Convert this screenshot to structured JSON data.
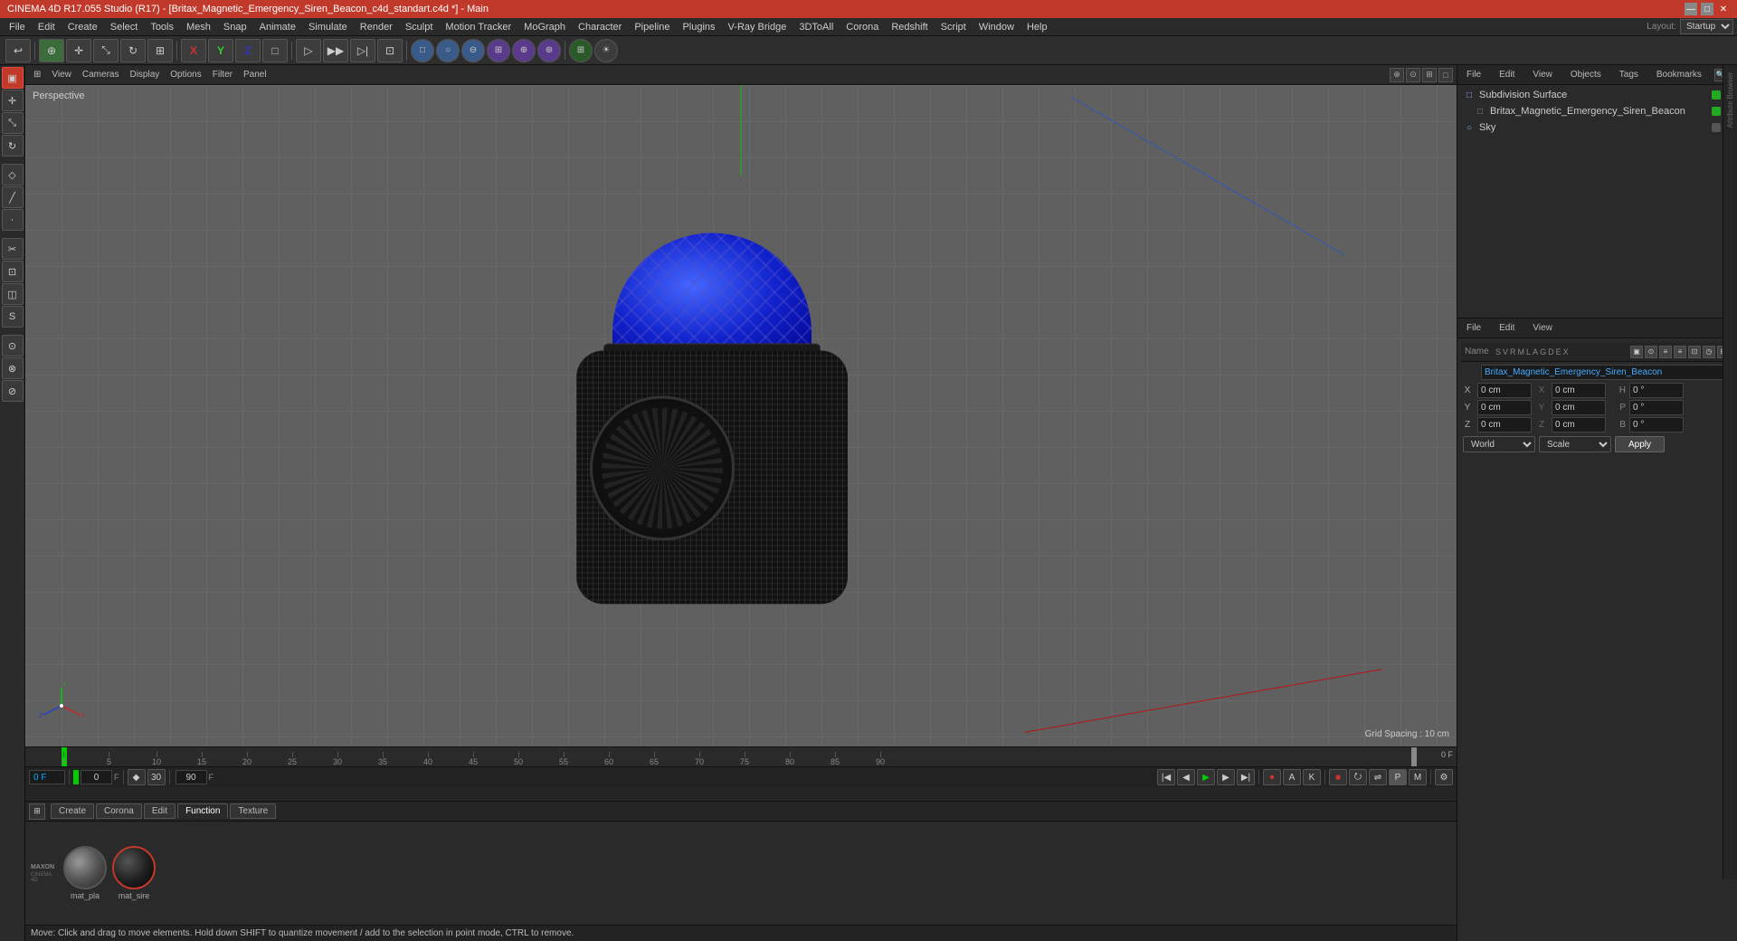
{
  "titleBar": {
    "title": "CINEMA 4D R17.055 Studio (R17) - [Britax_Magnetic_Emergency_Siren_Beacon_c4d_standart.c4d *] - Main",
    "minimize": "—",
    "maximize": "□",
    "close": "✕"
  },
  "menuBar": {
    "items": [
      "File",
      "Edit",
      "Create",
      "Select",
      "Tools",
      "Mesh",
      "Snap",
      "Animate",
      "Simulate",
      "Render",
      "Sculpt",
      "Motion Tracker",
      "MoGraph",
      "Character",
      "Pipeline",
      "Plugins",
      "V-Ray Bridge",
      "3DToAll",
      "Corona",
      "Redshift",
      "Script",
      "Window",
      "Help"
    ]
  },
  "layout": {
    "label": "Layout:",
    "value": "Startup"
  },
  "viewport": {
    "perspectiveLabel": "Perspective",
    "gridSpacing": "Grid Spacing : 10 cm",
    "tabs": [
      "View",
      "Cameras",
      "Display",
      "Options",
      "Filter",
      "Panel"
    ]
  },
  "objectManager": {
    "tabs": [
      "File",
      "Edit",
      "View",
      "Objects",
      "Tags",
      "Bookmarks"
    ],
    "objects": [
      {
        "name": "Subdivision Surface",
        "level": 0,
        "icon": "□",
        "dotColors": [
          "green",
          "orange"
        ]
      },
      {
        "name": "Britax_Magnetic_Emergency_Siren_Beacon",
        "level": 1,
        "icon": "□",
        "dotColors": [
          "green",
          "orange"
        ]
      },
      {
        "name": "Sky",
        "level": 0,
        "icon": "○",
        "dotColors": [
          "grey",
          "orange"
        ]
      }
    ]
  },
  "attrManager": {
    "tabs": [
      "File",
      "Edit",
      "View"
    ],
    "nameLabel": "Name",
    "nameValue": "Britax_Magnetic_Emergency_Siren_Beacon",
    "headers": [
      "S",
      "V",
      "R",
      "M",
      "L",
      "A",
      "G",
      "D",
      "E",
      "X"
    ],
    "coords": {
      "x": {
        "pos": "0 cm",
        "scale": "0 cm",
        "angle": "0 °"
      },
      "y": {
        "pos": "0 cm",
        "scale": "0 cm",
        "angle": "0 °"
      },
      "z": {
        "pos": "0 cm",
        "scale": "0 cm",
        "angle": "0 °"
      }
    },
    "coordLabels": {
      "H": "H",
      "P": "P",
      "B": "B"
    },
    "worldLabel": "World",
    "scaleLabel": "Scale",
    "applyLabel": "Apply"
  },
  "timeline": {
    "currentFrame": "0 F",
    "startFrame": "0 F",
    "endFrame": "90 F",
    "fps": "30",
    "ticks": [
      "0",
      "5",
      "10",
      "15",
      "20",
      "25",
      "30",
      "35",
      "40",
      "45",
      "50",
      "55",
      "60",
      "65",
      "70",
      "75",
      "80",
      "85",
      "90"
    ]
  },
  "bottomPanel": {
    "tabs": [
      "Create",
      "Corona",
      "Edit",
      "Function",
      "Texture"
    ],
    "materials": [
      {
        "name": "mat_pla",
        "type": "grey"
      },
      {
        "name": "mat_sire",
        "type": "dark"
      }
    ]
  },
  "statusBar": {
    "message": "Move: Click and drag to move elements. Hold down SHIFT to quantize movement / add to the selection in point mode, CTRL to remove."
  },
  "rightSidebarTabs": [
    "Attribute Browser"
  ],
  "icons": {
    "move": "⊕",
    "rotate": "↻",
    "scale": "⊞",
    "select": "▣",
    "xaxis": "X",
    "yaxis": "Y",
    "zaxis": "Z",
    "play": "▶",
    "stop": "■",
    "rewind": "◀◀",
    "forward": "▶▶",
    "record": "⏺",
    "keyframe": "◆"
  }
}
